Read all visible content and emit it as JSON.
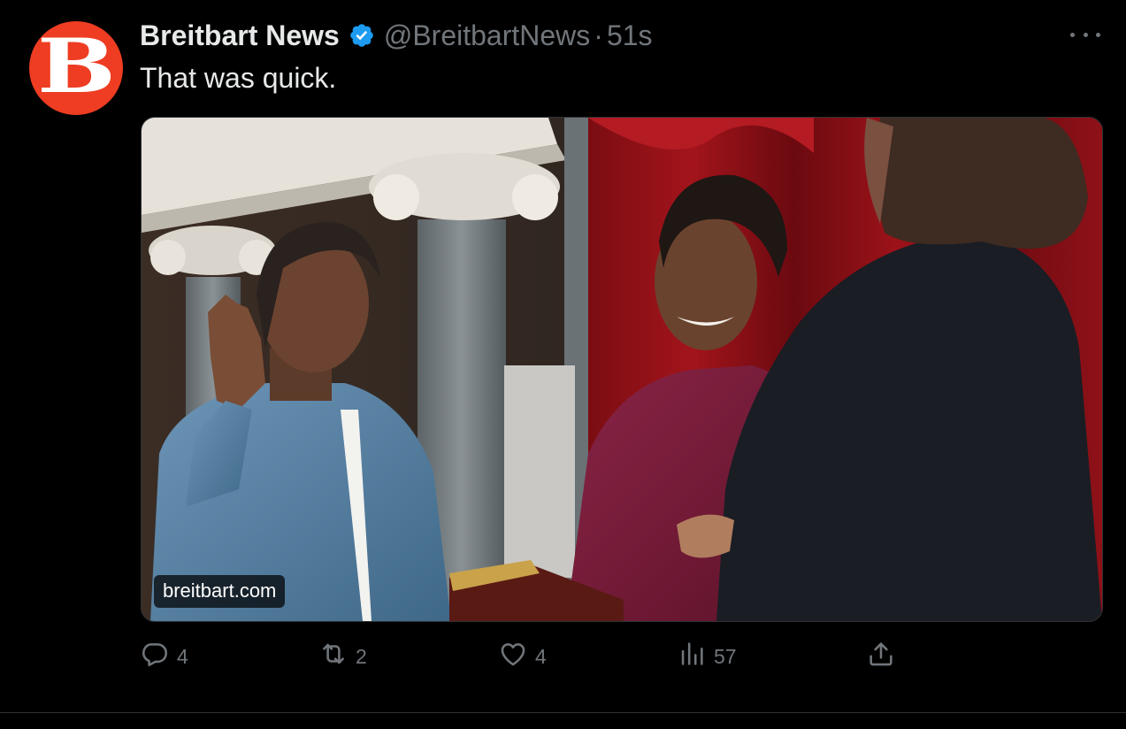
{
  "post": {
    "author_name": "Breitbart News",
    "author_handle": "@BreitbartNews",
    "separator": "·",
    "timestamp": "51s",
    "avatar_letter": "B",
    "avatar_color": "#ee3d22",
    "verified_color": "#1d9bf0",
    "text": "That was quick.",
    "media": {
      "watermark": "breitbart.com"
    }
  },
  "actions": {
    "replies": "4",
    "reposts": "2",
    "likes": "4",
    "views": "57"
  },
  "icons": {
    "reply": "reply-icon",
    "repost": "repost-icon",
    "like": "like-icon",
    "views": "views-icon",
    "share": "share-icon",
    "more": "more-icon",
    "verified": "verified-badge-icon"
  },
  "colors": {
    "background": "#000000",
    "text_primary": "#e7e9ea",
    "text_secondary": "#71767b"
  }
}
